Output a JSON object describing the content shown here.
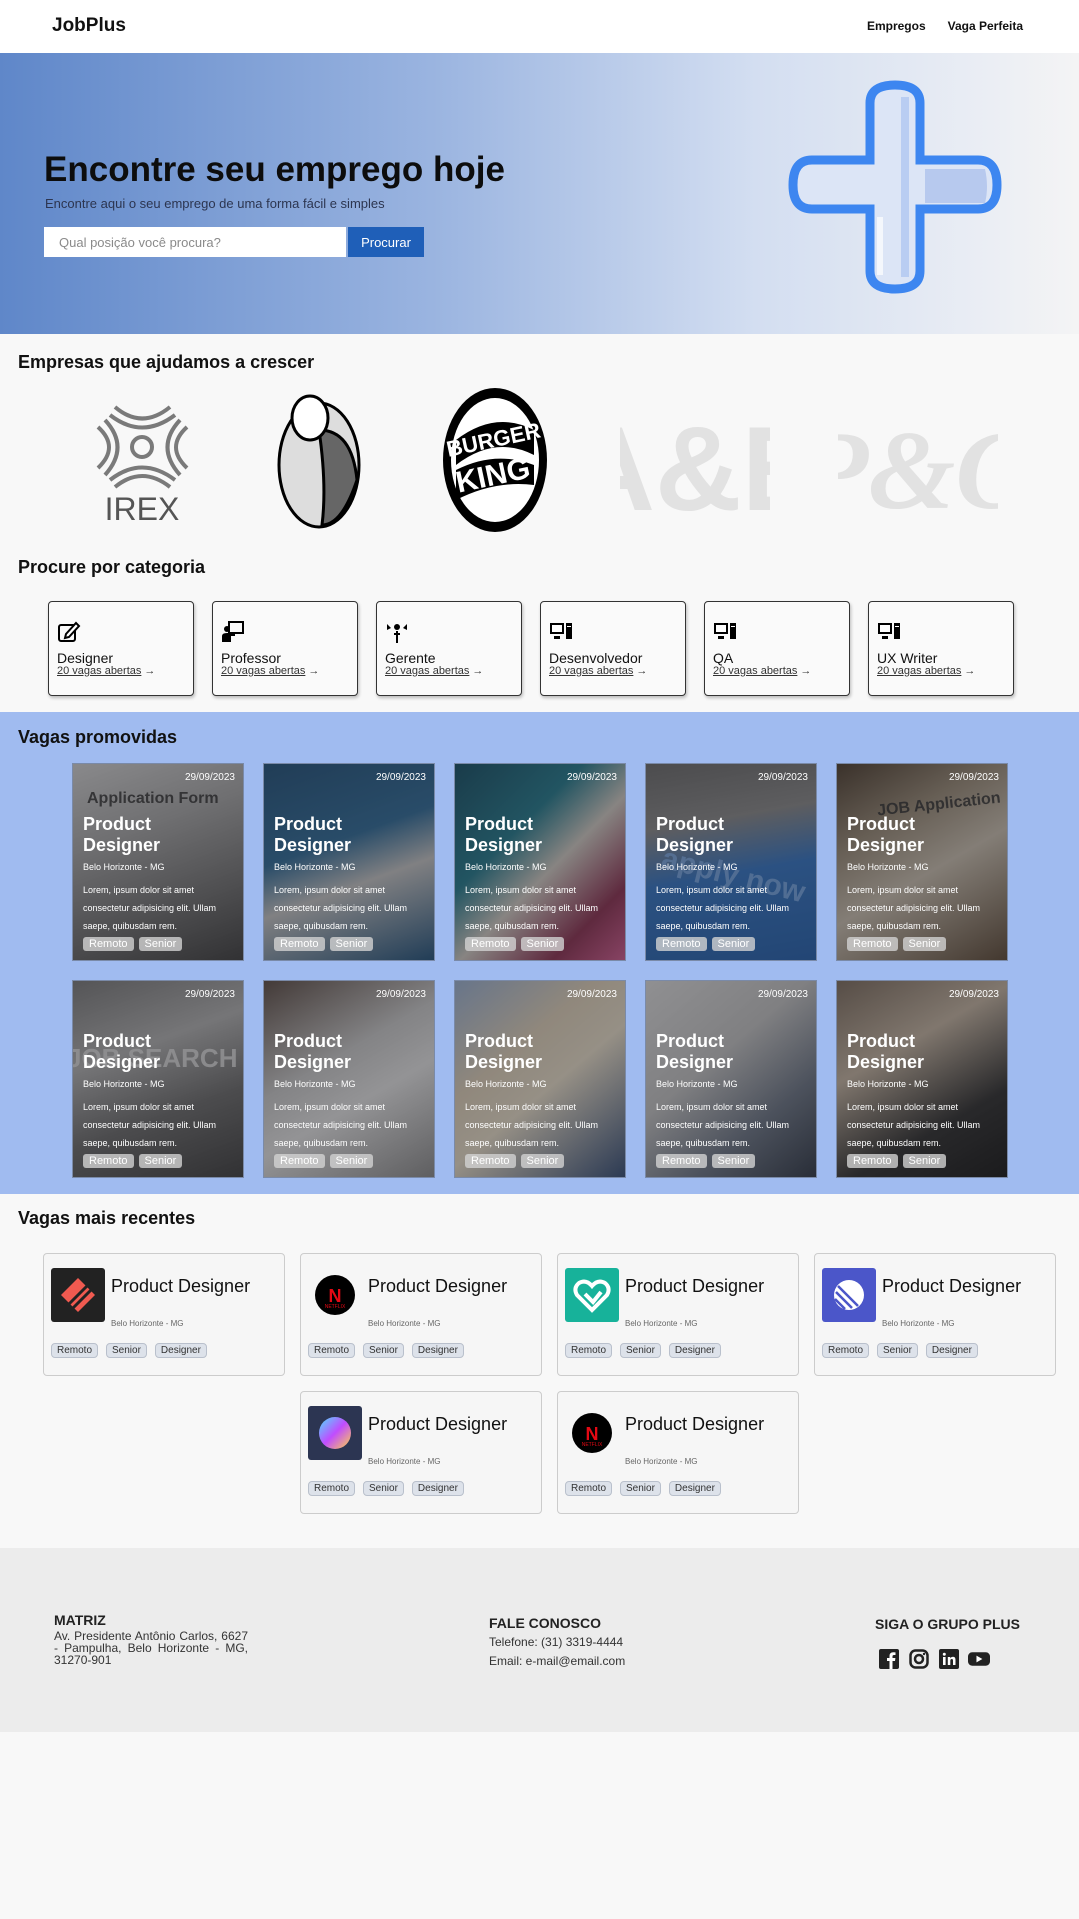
{
  "header": {
    "brand": "JobPlus",
    "nav": [
      "Empregos",
      "Vaga Perfeita"
    ]
  },
  "hero": {
    "title": "Encontre seu emprego hoje",
    "subtitle": "Encontre aqui o seu emprego de uma forma fácil e simples",
    "search_placeholder": "Qual posição você procura?",
    "search_button": "Procurar"
  },
  "companies": {
    "title": "Empresas que ajudamos a crescer",
    "logos": [
      "IREX",
      "BURGER KING",
      "A&E",
      "P&G"
    ]
  },
  "categories": {
    "title": "Procure por categoria",
    "items": [
      {
        "name": "Designer",
        "openings": "20 vagas abertas",
        "icon": "pencil-square-icon"
      },
      {
        "name": "Professor",
        "openings": "20 vagas abertas",
        "icon": "teacher-board-icon"
      },
      {
        "name": "Gerente",
        "openings": "20 vagas abertas",
        "icon": "manager-icon"
      },
      {
        "name": "Desenvolvedor",
        "openings": "20 vagas abertas",
        "icon": "computer-icon"
      },
      {
        "name": "QA",
        "openings": "20 vagas abertas",
        "icon": "computer-icon"
      },
      {
        "name": "UX Writer",
        "openings": "20 vagas abertas",
        "icon": "computer-icon"
      }
    ]
  },
  "promoted": {
    "title": "Vagas promovidas",
    "cards": [
      {
        "date": "29/09/2023",
        "title": "Product Designer",
        "location": "Belo Horizonte - MG",
        "description": "Lorem, ipsum dolor sit amet consectetur adipisicing elit. Ullam saepe, quibusdam rem.",
        "tags": [
          "Remoto",
          "Senior"
        ],
        "photo": "Application Form"
      },
      {
        "date": "29/09/2023",
        "title": "Product Designer",
        "location": "Belo Horizonte - MG",
        "description": "Lorem, ipsum dolor sit amet consectetur adipisicing elit. Ullam saepe, quibusdam rem.",
        "tags": [
          "Remoto",
          "Senior"
        ],
        "photo": ""
      },
      {
        "date": "29/09/2023",
        "title": "Product Designer",
        "location": "Belo Horizonte - MG",
        "description": "Lorem, ipsum dolor sit amet consectetur adipisicing elit. Ullam saepe, quibusdam rem.",
        "tags": [
          "Remoto",
          "Senior"
        ],
        "photo": ""
      },
      {
        "date": "29/09/2023",
        "title": "Product Designer",
        "location": "Belo Horizonte - MG",
        "description": "Lorem, ipsum dolor sit amet consectetur adipisicing elit. Ullam saepe, quibusdam rem.",
        "tags": [
          "Remoto",
          "Senior"
        ],
        "photo": "apply now"
      },
      {
        "date": "29/09/2023",
        "title": "Product Designer",
        "location": "Belo Horizonte - MG",
        "description": "Lorem, ipsum dolor sit amet consectetur adipisicing elit. Ullam saepe, quibusdam rem.",
        "tags": [
          "Remoto",
          "Senior"
        ],
        "photo": "JOB Application"
      },
      {
        "date": "29/09/2023",
        "title": "Product Designer",
        "location": "Belo Horizonte - MG",
        "description": "Lorem, ipsum dolor sit amet consectetur adipisicing elit. Ullam saepe, quibusdam rem.",
        "tags": [
          "Remoto",
          "Senior"
        ],
        "photo": "JOB SEARCH"
      },
      {
        "date": "29/09/2023",
        "title": "Product Designer",
        "location": "Belo Horizonte - MG",
        "description": "Lorem, ipsum dolor sit amet consectetur adipisicing elit. Ullam saepe, quibusdam rem.",
        "tags": [
          "Remoto",
          "Senior"
        ],
        "photo": ""
      },
      {
        "date": "29/09/2023",
        "title": "Product Designer",
        "location": "Belo Horizonte - MG",
        "description": "Lorem, ipsum dolor sit amet consectetur adipisicing elit. Ullam saepe, quibusdam rem.",
        "tags": [
          "Remoto",
          "Senior"
        ],
        "photo": ""
      },
      {
        "date": "29/09/2023",
        "title": "Product Designer",
        "location": "Belo Horizonte - MG",
        "description": "Lorem, ipsum dolor sit amet consectetur adipisicing elit. Ullam saepe, quibusdam rem.",
        "tags": [
          "Remoto",
          "Senior"
        ],
        "photo": ""
      },
      {
        "date": "29/09/2023",
        "title": "Product Designer",
        "location": "Belo Horizonte - MG",
        "description": "Lorem, ipsum dolor sit amet consectetur adipisicing elit. Ullam saepe, quibusdam rem.",
        "tags": [
          "Remoto",
          "Senior"
        ],
        "photo": ""
      }
    ]
  },
  "recent": {
    "title": "Vagas mais recentes",
    "cards": [
      {
        "title": "Product Designer",
        "location": "Belo Horizonte - MG",
        "tags": [
          "Remoto",
          "Senior",
          "Designer"
        ],
        "logo": "red-diamond-logo"
      },
      {
        "title": "Product Designer",
        "location": "Belo Horizonte - MG",
        "tags": [
          "Remoto",
          "Senior",
          "Designer"
        ],
        "logo": "netflix-logo"
      },
      {
        "title": "Product Designer",
        "location": "Belo Horizonte - MG",
        "tags": [
          "Remoto",
          "Senior",
          "Designer"
        ],
        "logo": "green-heart-logo"
      },
      {
        "title": "Product Designer",
        "location": "Belo Horizonte - MG",
        "tags": [
          "Remoto",
          "Senior",
          "Designer"
        ],
        "logo": "linear-logo"
      },
      {
        "title": "Product Designer",
        "location": "Belo Horizonte - MG",
        "tags": [
          "Remoto",
          "Senior",
          "Designer"
        ],
        "logo": "gradient-orb-logo"
      },
      {
        "title": "Product Designer",
        "location": "Belo Horizonte - MG",
        "tags": [
          "Remoto",
          "Senior",
          "Designer"
        ],
        "logo": "netflix-logo"
      }
    ]
  },
  "footer": {
    "matriz_title": "MATRIZ",
    "matriz_address": "Av. Presidente Antônio Carlos, 6627 - Pampulha, Belo Horizonte - MG, 31270-901",
    "contact_title": "FALE CONOSCO",
    "phone": "Telefone: (31) 3319-4444",
    "email": "Email: e-mail@email.com",
    "social_title": "SIGA O GRUPO PLUS",
    "social": [
      "facebook-icon",
      "instagram-icon",
      "linkedin-icon",
      "youtube-icon"
    ]
  },
  "colors": {
    "accent": "#1f5fb8",
    "promo_bg": "#a0bbf0",
    "plus_blue": "#3d86f0"
  }
}
